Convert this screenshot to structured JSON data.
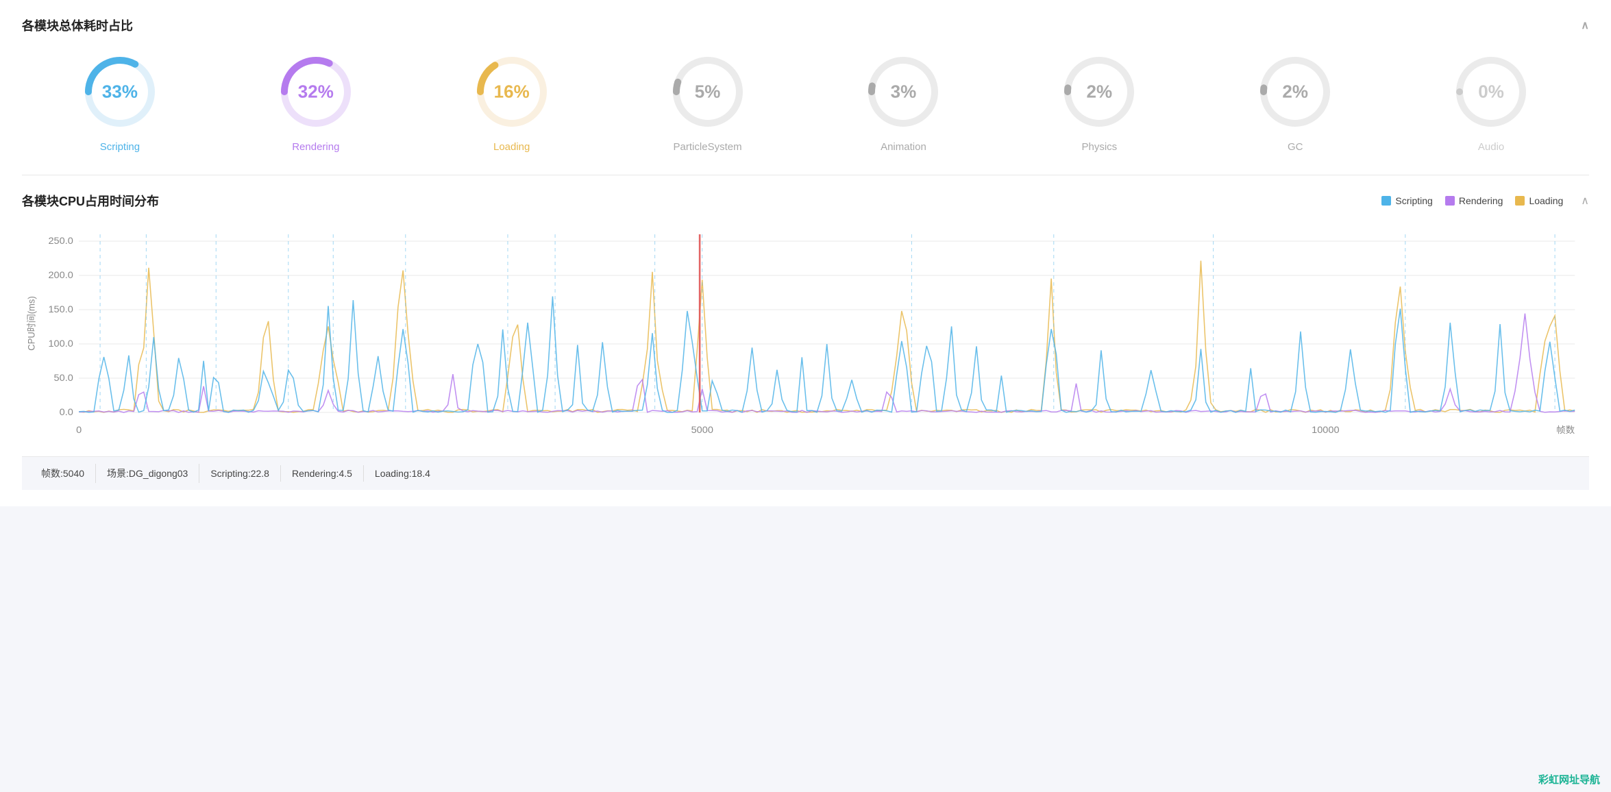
{
  "section1": {
    "title": "各模块总体耗时占比",
    "modules": [
      {
        "id": "scripting",
        "label": "Scripting",
        "percent": "33%",
        "value": 33,
        "color": "#4eb3e8",
        "trackColor": "#e0f0fa"
      },
      {
        "id": "rendering",
        "label": "Rendering",
        "percent": "32%",
        "value": 32,
        "color": "#b57bee",
        "trackColor": "#ede0fa"
      },
      {
        "id": "loading",
        "label": "Loading",
        "percent": "16%",
        "value": 16,
        "color": "#e8b84e",
        "trackColor": "#faf0e0"
      },
      {
        "id": "particlesystem",
        "label": "ParticleSystem",
        "percent": "5%",
        "value": 5,
        "color": "#aaa",
        "trackColor": "#ebebeb"
      },
      {
        "id": "animation",
        "label": "Animation",
        "percent": "3%",
        "value": 3,
        "color": "#aaa",
        "trackColor": "#ebebeb"
      },
      {
        "id": "physics",
        "label": "Physics",
        "percent": "2%",
        "value": 2,
        "color": "#aaa",
        "trackColor": "#ebebeb"
      },
      {
        "id": "gc",
        "label": "GC",
        "percent": "2%",
        "value": 2,
        "color": "#aaa",
        "trackColor": "#ebebeb"
      },
      {
        "id": "audio",
        "label": "Audio",
        "percent": "0%",
        "value": 0,
        "color": "#ccc",
        "trackColor": "#ebebeb"
      }
    ]
  },
  "section2": {
    "title": "各模块CPU占用时间分布",
    "legend": [
      {
        "label": "Scripting",
        "color": "#4eb3e8"
      },
      {
        "label": "Rendering",
        "color": "#b57bee"
      },
      {
        "label": "Loading",
        "color": "#e8b84e"
      }
    ],
    "yAxisLabel": "CPU时间(ms)",
    "yTicks": [
      "250.0",
      "200.0",
      "150.0",
      "100.0",
      "50.0",
      "0.0"
    ],
    "xTicks": [
      "0",
      "5000",
      "10000"
    ],
    "xAxisLabel": "帧数"
  },
  "statusBar": {
    "frame": "帧数:5040",
    "scene": "场景:DG_digong03",
    "scripting": "Scripting:22.8",
    "rendering": "Rendering:4.5",
    "loading": "Loading:18.4"
  },
  "brand": "彩虹网址导航"
}
